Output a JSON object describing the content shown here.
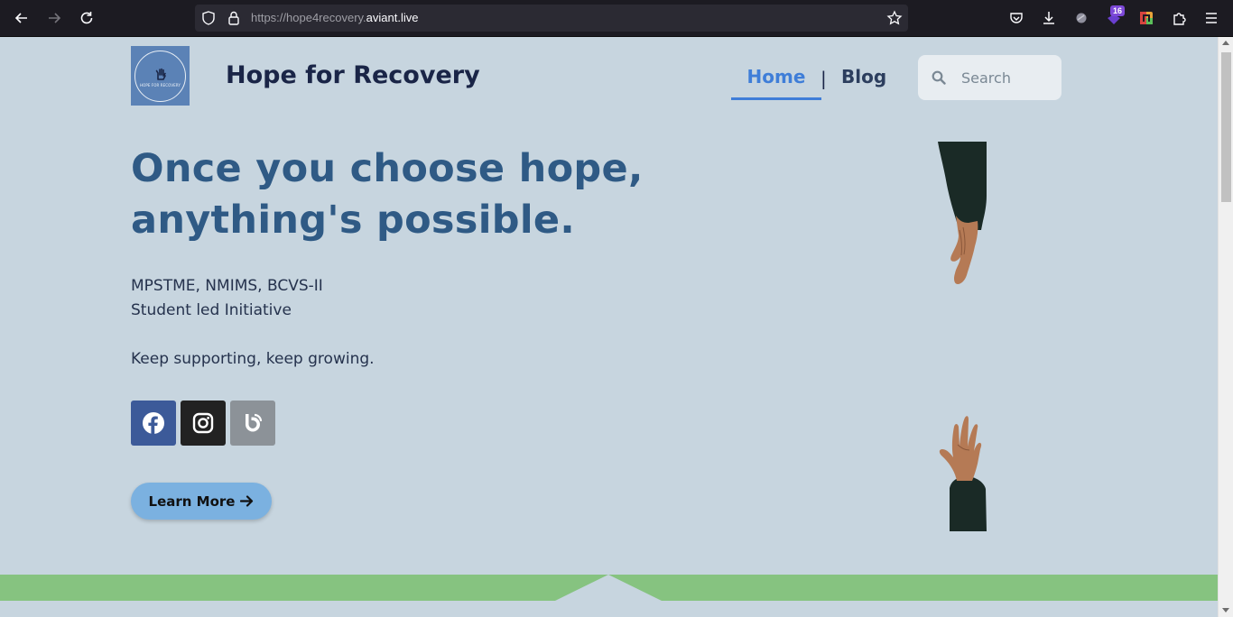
{
  "browser": {
    "url_prefix": "https://hope4recovery.",
    "url_domain": "aviant.live",
    "extension_badge": "16"
  },
  "site": {
    "logo_text": "HOPE FOR RECOVERY",
    "brand": "Hope for Recovery",
    "nav": {
      "home": "Home",
      "separator": "|",
      "blog": "Blog"
    },
    "search_placeholder": "Search"
  },
  "hero": {
    "headline": "Once you choose hope, anything's possible.",
    "line1": "MPSTME, NMIMS, BCVS-II",
    "line2": "Student led Initiative",
    "tagline": "Keep supporting, keep growing.",
    "cta_label": "Learn More"
  },
  "colors": {
    "page_bg": "#c7d5df",
    "brand_text": "#1a2547",
    "headline": "#2f5a85",
    "nav_active": "#3f7ed8",
    "cta_bg": "#7bb1e0",
    "facebook": "#3c5a99",
    "instagram": "#222222",
    "blogger": "#8c9298",
    "band": "#86c380"
  },
  "icons": {
    "social": [
      "facebook-icon",
      "instagram-icon",
      "blogger-icon"
    ],
    "cta": "arrow-right-icon"
  }
}
